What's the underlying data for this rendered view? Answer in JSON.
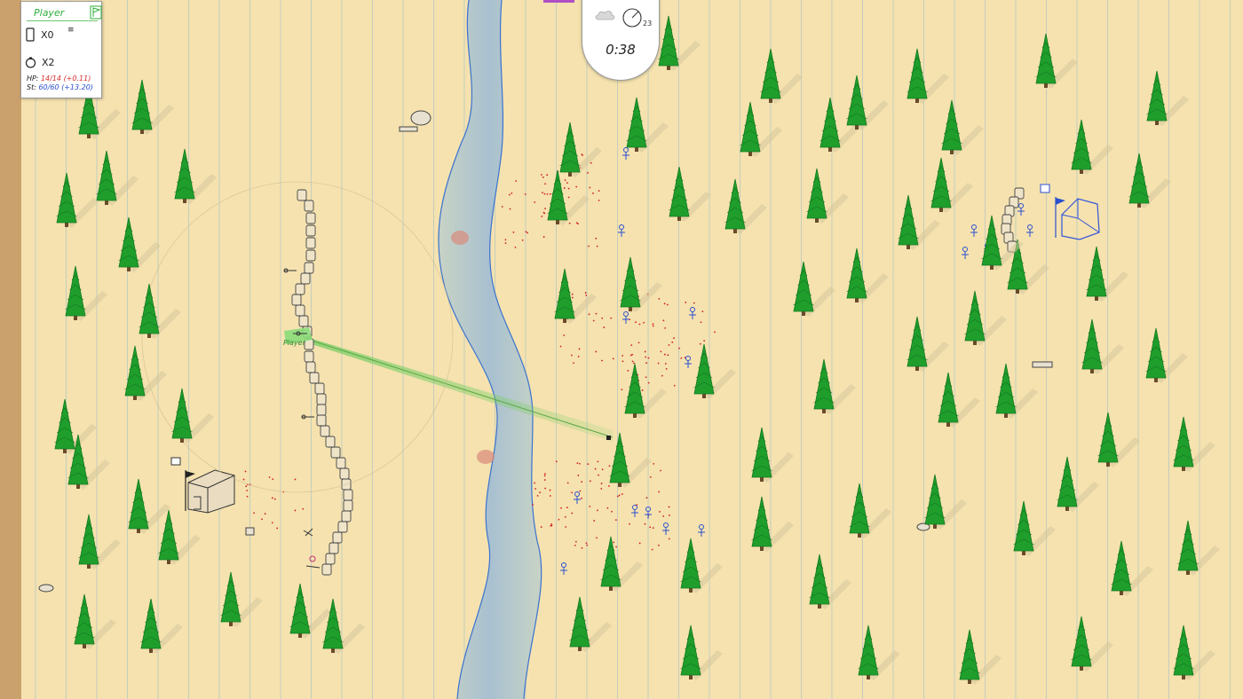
{
  "hud": {
    "player_name": "Player",
    "flag_icon": "flag-icon",
    "phone_icon": "phone-icon",
    "grenade_icon": "grenade-icon",
    "menu_icon": "menu-lines-icon",
    "phone_count": "X0",
    "grenade_count": "X2",
    "hp_label": "HP:",
    "hp_value": "14/14",
    "hp_regen": "(+0.11)",
    "stamina_label": "St:",
    "stamina_value": "60/60",
    "stamina_regen": "(+13.20)"
  },
  "timer": {
    "time": "0:38",
    "wind_speed": "23",
    "cloud_icon": "cloud-icon",
    "wind_icon": "wind-gauge-icon"
  },
  "map": {
    "player_unit_label": "Player",
    "colors": {
      "paper": "#f5e2af",
      "river": "#b5c9c8",
      "river_edge": "#3a72d0",
      "tree": "#1f9e2c",
      "friendly": "#2b8a2f",
      "enemy": "#2b4fd0",
      "blood": "#d02020",
      "lines": "#a9c2c4"
    }
  }
}
